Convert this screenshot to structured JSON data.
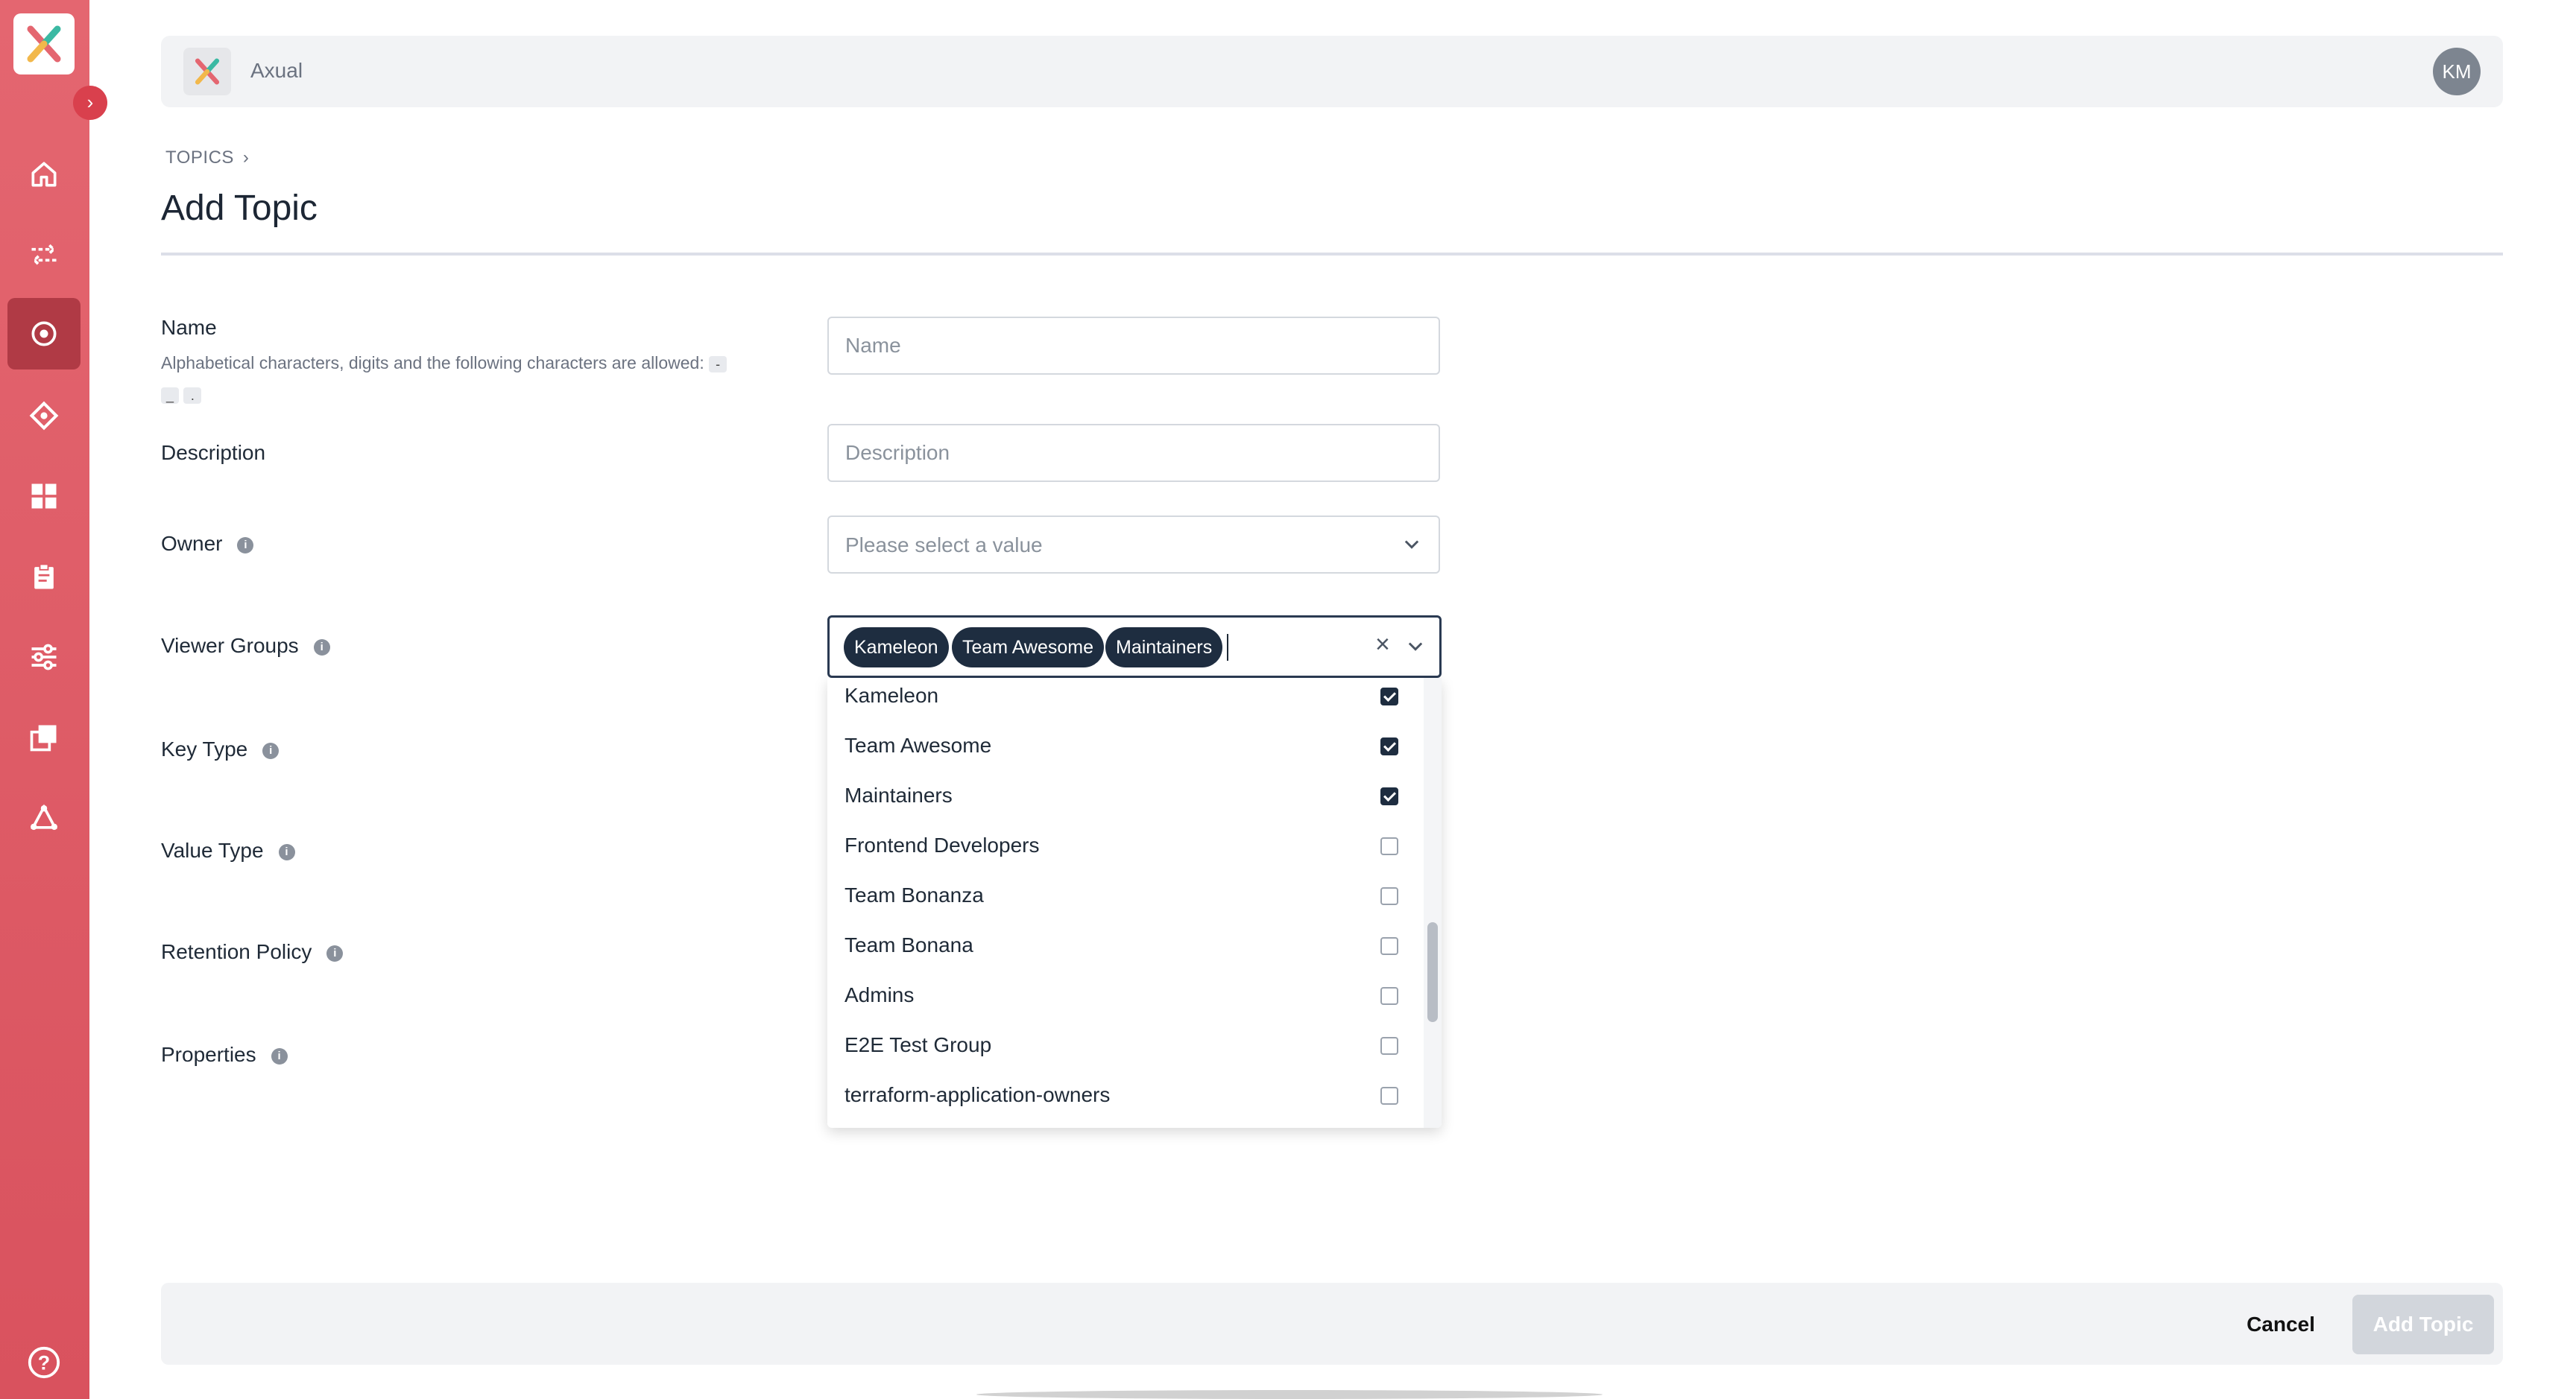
{
  "app": {
    "name": "Axual",
    "user_initials": "KM"
  },
  "colors": {
    "sidebar": "#e05a66",
    "active_nav": "#b03a45",
    "chip": "#1e2d40",
    "disabled_button": "#d2d6dc"
  },
  "sidebar": {
    "items": [
      {
        "icon": "home-icon"
      },
      {
        "icon": "streams-icon"
      },
      {
        "icon": "topics-icon",
        "active": true
      },
      {
        "icon": "applications-icon"
      },
      {
        "icon": "dashboard-icon"
      },
      {
        "icon": "clipboard-icon"
      },
      {
        "icon": "settings-sliders-icon"
      },
      {
        "icon": "copy-icon"
      },
      {
        "icon": "network-icon"
      }
    ],
    "help_icon": "help-icon"
  },
  "breadcrumb": {
    "topics": "TOPICS"
  },
  "page": {
    "title": "Add Topic"
  },
  "form": {
    "name": {
      "label": "Name",
      "hint": "Alphabetical characters, digits and the following characters are allowed:",
      "allowed_chars": [
        "-",
        "_",
        "."
      ],
      "placeholder": "Name"
    },
    "description": {
      "label": "Description",
      "placeholder": "Description"
    },
    "owner": {
      "label": "Owner",
      "placeholder": "Please select a value"
    },
    "viewer_groups": {
      "label": "Viewer Groups",
      "selected": [
        "Kameleon",
        "Team Awesome",
        "Maintainers"
      ],
      "options": [
        {
          "label": "Kameleon",
          "checked": true
        },
        {
          "label": "Team Awesome",
          "checked": true
        },
        {
          "label": "Maintainers",
          "checked": true
        },
        {
          "label": "Frontend Developers",
          "checked": false
        },
        {
          "label": "Team Bonanza",
          "checked": false
        },
        {
          "label": "Team Bonana",
          "checked": false
        },
        {
          "label": "Admins",
          "checked": false
        },
        {
          "label": "E2E Test Group",
          "checked": false
        },
        {
          "label": "terraform-application-owners",
          "checked": false
        }
      ]
    },
    "key_type": {
      "label": "Key Type"
    },
    "value_type": {
      "label": "Value Type"
    },
    "retention_policy": {
      "label": "Retention Policy"
    },
    "properties": {
      "label": "Properties"
    }
  },
  "footer": {
    "cancel_label": "Cancel",
    "submit_label": "Add Topic"
  }
}
